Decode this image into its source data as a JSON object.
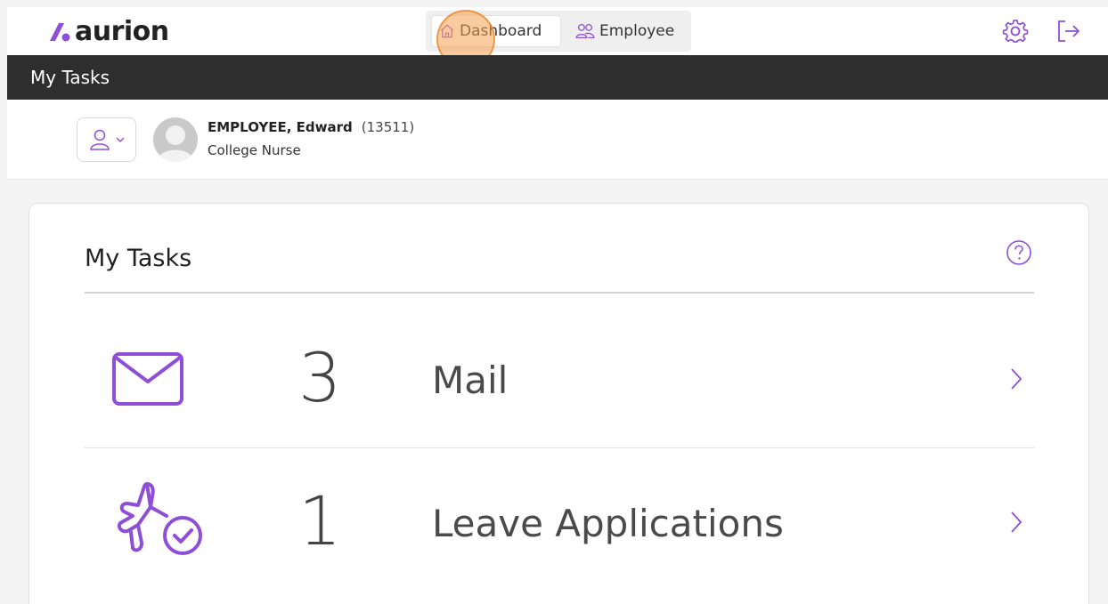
{
  "app": {
    "logo_text": "aurion"
  },
  "nav": {
    "dashboard_label": "Dashboard",
    "employee_label": "Employee"
  },
  "header": {
    "title": "My Tasks"
  },
  "employee": {
    "name": "EMPLOYEE, Edward",
    "id": "(13511)",
    "role": "College Nurse"
  },
  "card": {
    "title": "My Tasks",
    "tasks": [
      {
        "icon": "mail-icon",
        "count": "3",
        "label": "Mail"
      },
      {
        "icon": "leave-plane-check-icon",
        "count": "1",
        "label": "Leave Applications"
      }
    ]
  },
  "colors": {
    "accent": "#8e4fd6",
    "dark_bar": "#2e2e2e",
    "highlight": "#f5a050"
  }
}
